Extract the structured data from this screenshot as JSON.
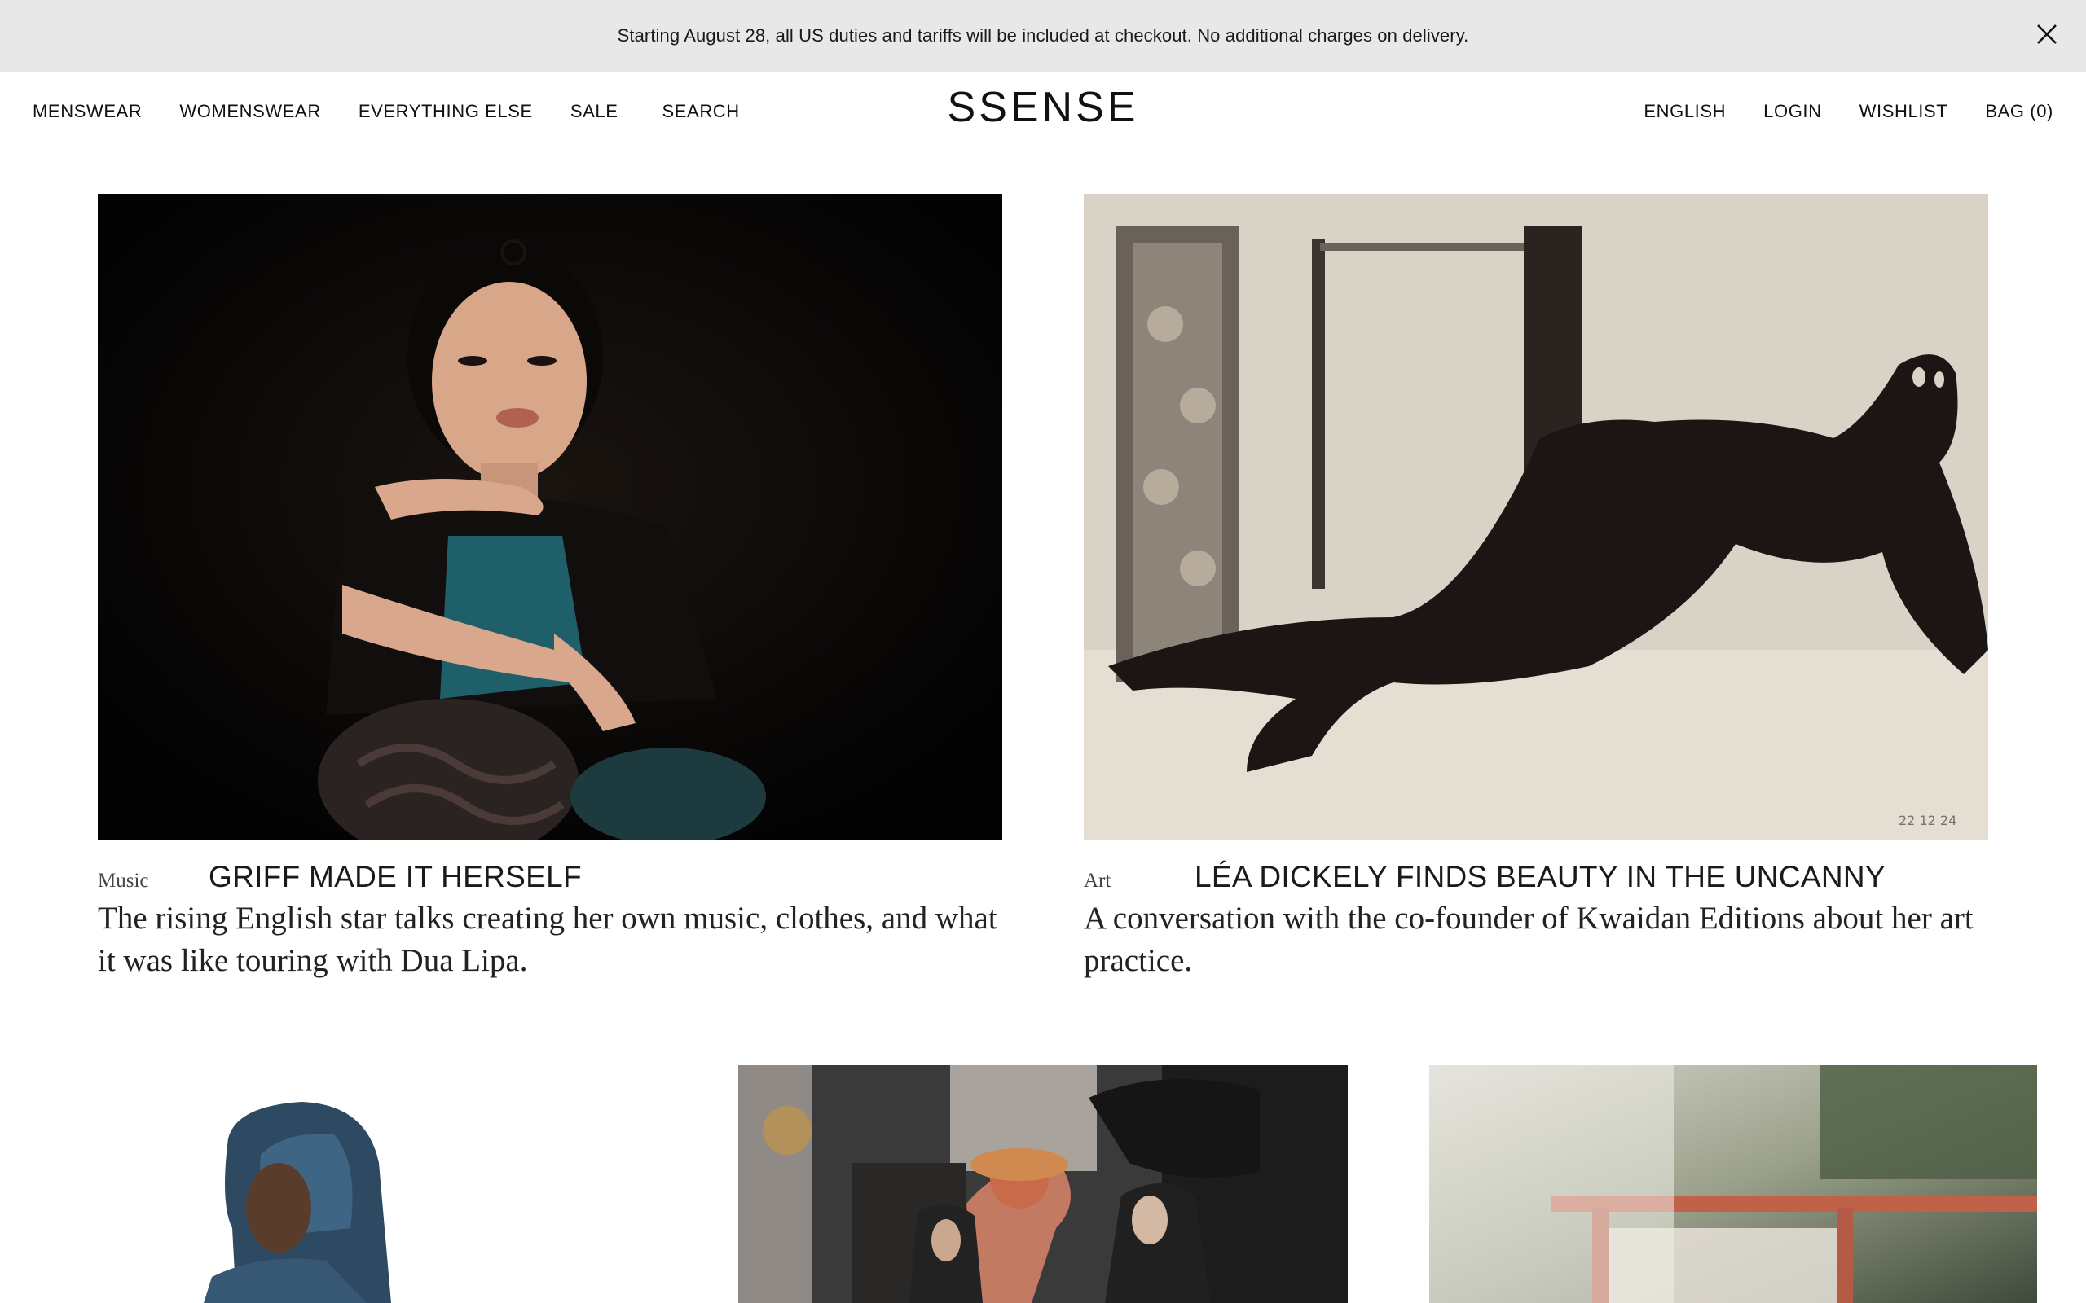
{
  "banner": {
    "text": "Starting August 28, all US duties and tariffs will be included at checkout. No additional charges on delivery.",
    "close_icon": "close-icon"
  },
  "nav": {
    "left": [
      "MENSWEAR",
      "WOMENSWEAR",
      "EVERYTHING ELSE",
      "SALE",
      "SEARCH"
    ],
    "logo": "SSENSE",
    "right": [
      "ENGLISH",
      "LOGIN",
      "WISHLIST",
      "BAG (0)"
    ]
  },
  "articles": [
    {
      "category": "Music",
      "title": "GRIFF MADE IT HERSELF",
      "description": "The rising English star talks creating her own music, clothes, and what it was like touring with Dua Lipa."
    },
    {
      "category": "Art",
      "title": "LÉA DICKELY FINDS BEAUTY IN THE UNCANNY",
      "description": "A conversation with the co-founder of Kwaidan Editions about her art practice."
    }
  ],
  "colors": {
    "banner_bg": "#e8e8e8",
    "text": "#111111",
    "background": "#ffffff"
  }
}
